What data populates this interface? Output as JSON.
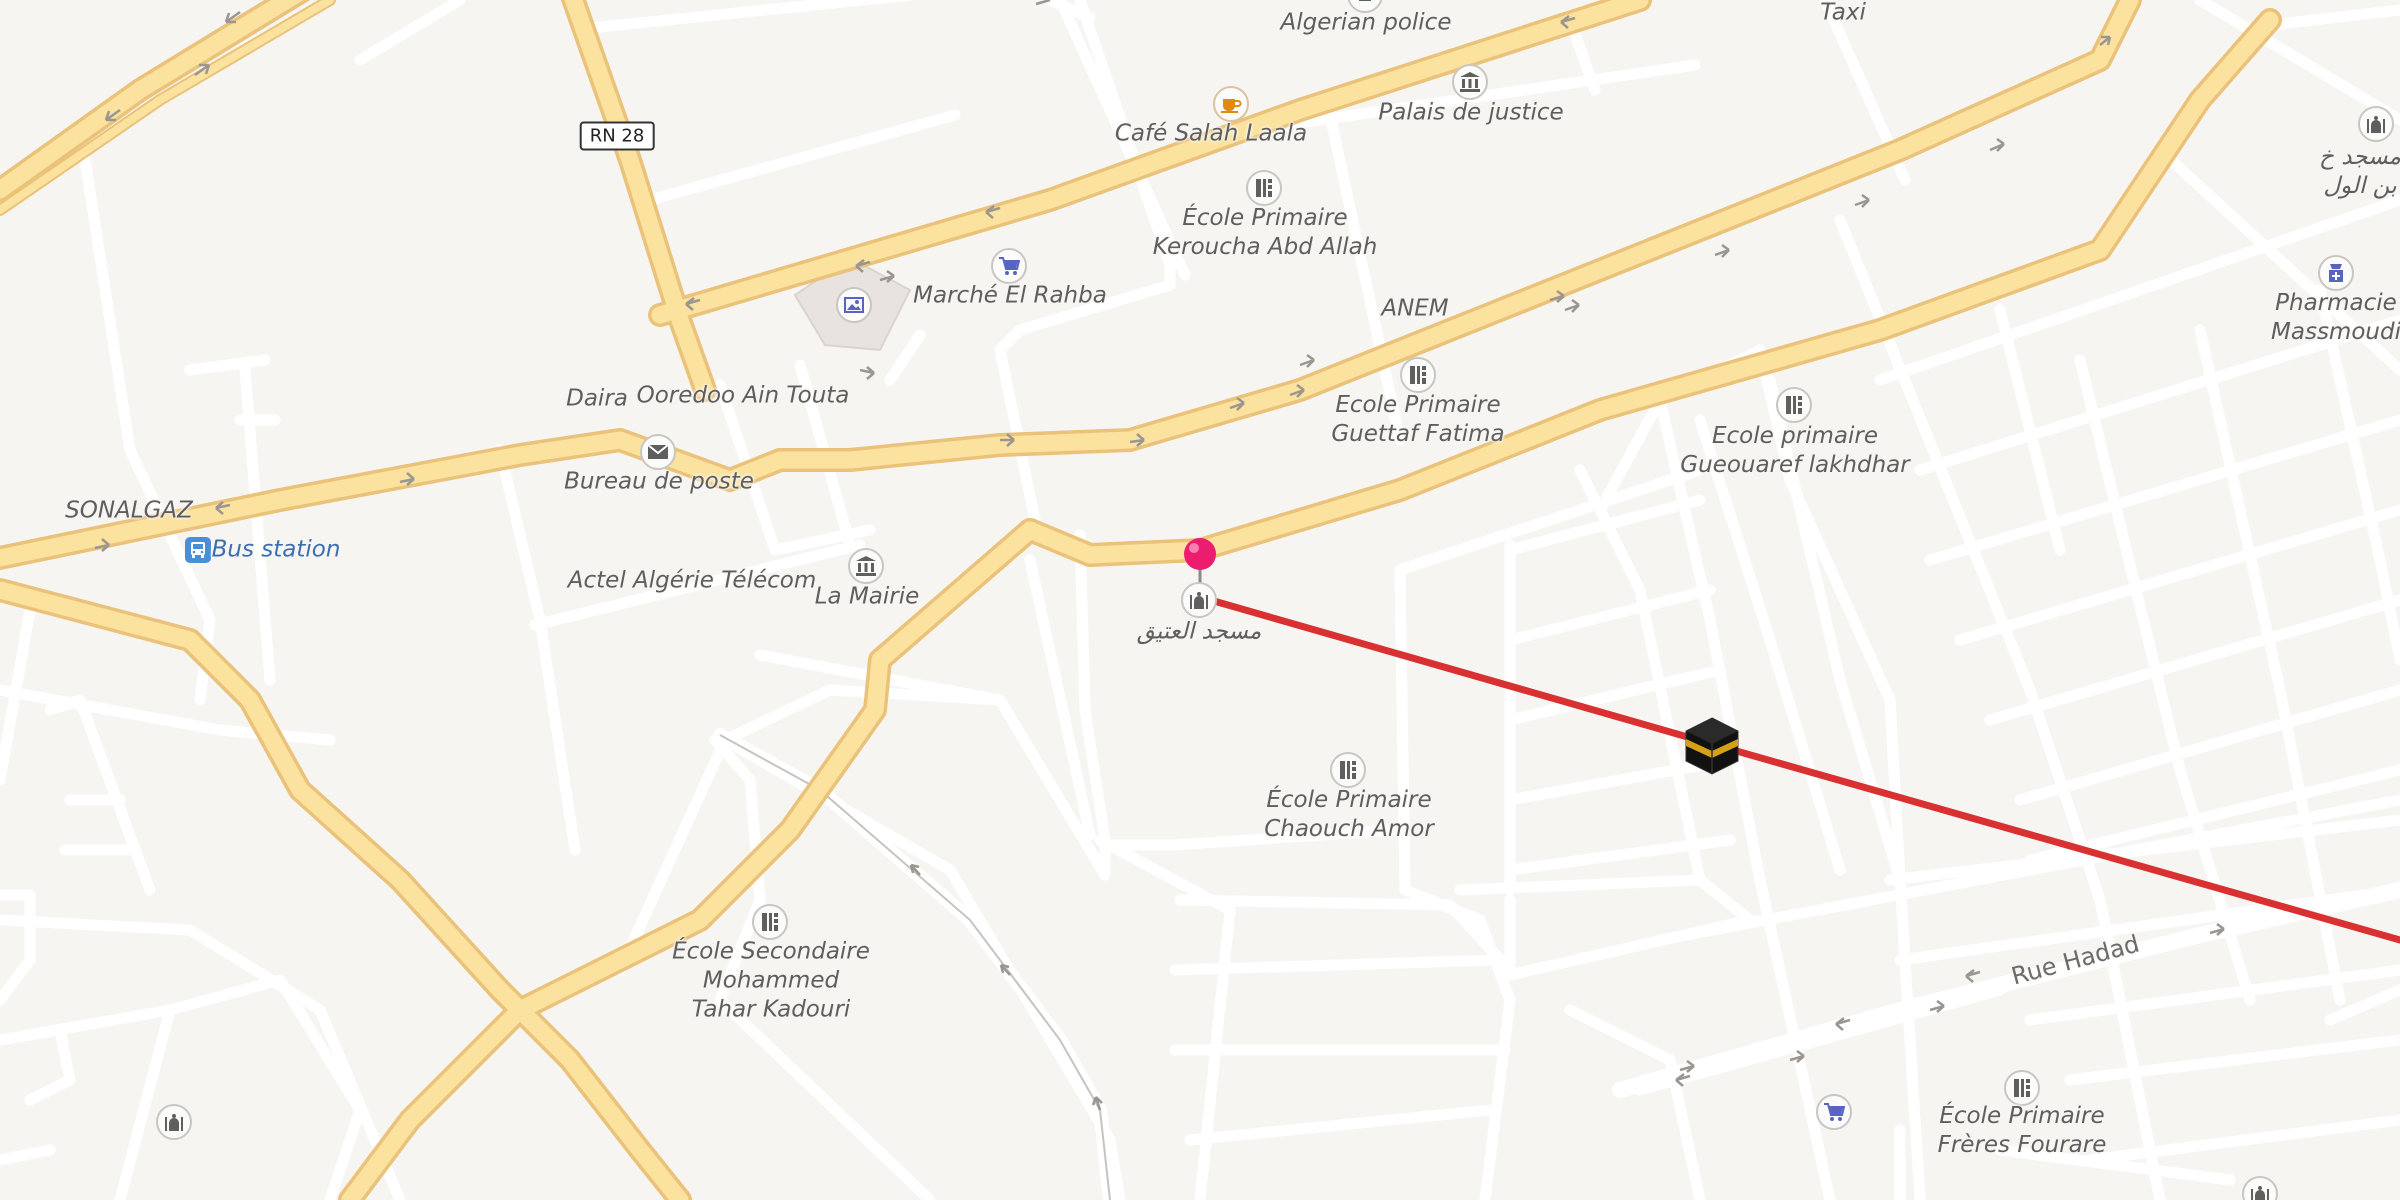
{
  "map": {
    "route_color": "#d93132",
    "road_primary_color": "#fbe29e",
    "road_primary_casing": "#eec67c",
    "road_minor_color": "#ffffff",
    "background_color": "#f7f5f2"
  },
  "labels": {
    "algerian_police": "Algerian police",
    "taxi": "Taxi",
    "cafe": "Café Salah Laala",
    "palais": "Palais de justice",
    "ecole_keroucha": [
      "École Primaire",
      "Keroucha Abd Allah"
    ],
    "marche": "Marché El Rahba",
    "anem": "ANEM",
    "ecole_guettaf": [
      "Ecole Primaire",
      "Guettaf Fatima"
    ],
    "ecole_gueouaref": [
      "Ecole primaire",
      "Gueouaref lakhdhar"
    ],
    "pharmacie": [
      "Pharmacie",
      "Massmoudi"
    ],
    "mosque_top_right": [
      "مسجد خ",
      "بن الول"
    ],
    "daira": "Daira",
    "ooredoo": "Ooredoo Ain Touta",
    "sonalgaz": "SONALGAZ",
    "bus_station": "Bus station",
    "bureau_poste": "Bureau de poste",
    "actel": "Actel Algérie Télécom",
    "la_mairie": "La Mairie",
    "mosque_center": "مسجد العتيق",
    "ecole_chaouch": [
      "École Primaire",
      "Chaouch Amor"
    ],
    "ecole_secondaire": [
      "École Secondaire",
      "Mohammed",
      "Tahar Kadouri"
    ],
    "rue_hadad": "Rue Hadad",
    "ecole_freres": [
      "École Primaire",
      "Frères Fourare"
    ],
    "rn28": "RN 28"
  },
  "icons": {
    "police": "police-icon",
    "cafe": "coffee-icon",
    "palais": "courthouse-icon",
    "school": "school-icon",
    "market": "shopping-cart-icon",
    "museum": "picture-icon",
    "post": "envelope-icon",
    "townhall": "townhall-icon",
    "mosque": "mosque-icon",
    "pharmacy": "pharmacy-icon",
    "bus": "bus-icon",
    "kaaba": "kaaba-qibla-icon",
    "pin": "location-pin-icon"
  }
}
